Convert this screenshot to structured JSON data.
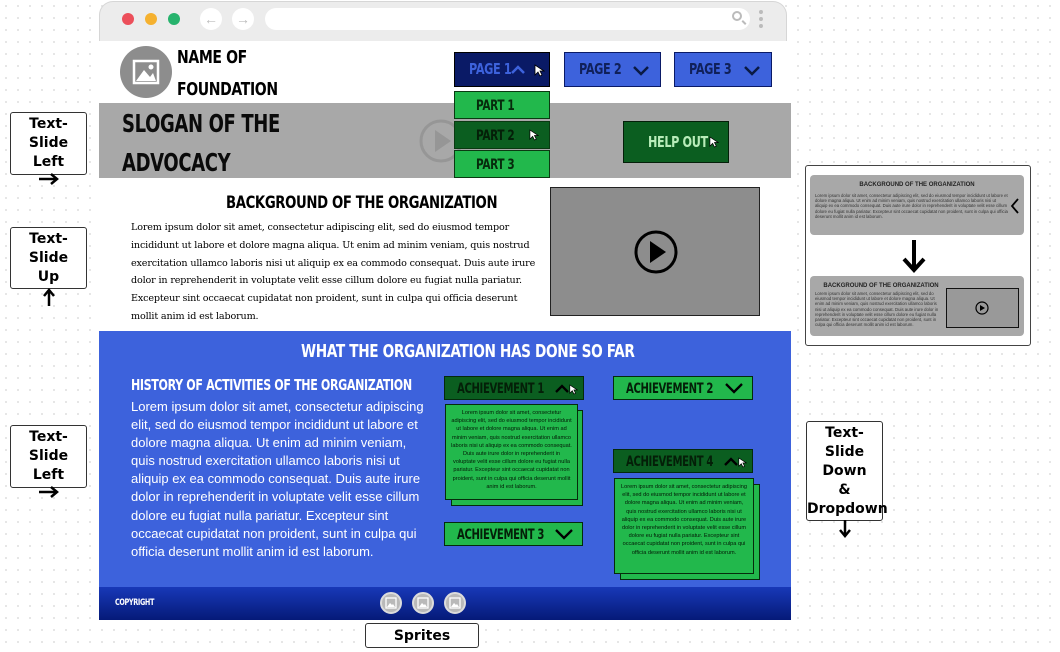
{
  "browser": {
    "dots": [
      "#ec4f5a",
      "#f5b12f",
      "#27b36d"
    ]
  },
  "header": {
    "name_line1": "NAME OF",
    "name_line2": "FOUNDATION",
    "nav": [
      {
        "label": "PAGE 1",
        "state": "open"
      },
      {
        "label": "PAGE 2",
        "state": "closed"
      },
      {
        "label": "PAGE 3",
        "state": "closed"
      }
    ],
    "dropdown": [
      "PART 1",
      "PART 2",
      "PART 3"
    ]
  },
  "hero": {
    "slogan_line1": "SLOGAN OF THE",
    "slogan_line2": "ADVOCACY",
    "help_button": "HELP OUT"
  },
  "background": {
    "title": "BACKGROUND OF THE ORGANIZATION",
    "paragraph": "Lorem ipsum dolor sit amet, consectetur adipiscing elit, sed do eiusmod tempor incididunt ut labore et dolore magna aliqua. Ut enim ad minim veniam, quis nostrud exercitation ullamco laboris nisi ut aliquip ex ea commodo consequat. Duis aute irure dolor in reprehenderit in voluptate velit esse cillum dolore eu fugiat nulla pariatur. Excepteur sint occaecat cupidatat non proident, sunt in culpa qui officia deserunt mollit anim id est laborum."
  },
  "activities": {
    "title": "WHAT THE ORGANIZATION HAS DONE SO FAR",
    "subtitle": "HISTORY OF ACTIVITIES OF THE ORGANIZATION",
    "paragraph": "Lorem ipsum dolor sit amet, consectetur adipiscing elit, sed do eiusmod tempor incididunt ut labore et dolore magna aliqua. Ut enim ad minim veniam, quis nostrud exercitation ullamco laboris nisi ut aliquip ex ea commodo consequat. Duis aute irure dolor in reprehenderit in voluptate velit esse cillum dolore eu fugiat nulla pariatur. Excepteur sint occaecat cupidatat non proident, sunt in culpa qui officia deserunt mollit anim id est laborum.",
    "achievements": [
      {
        "label": "ACHIEVEMENT 1",
        "state": "open"
      },
      {
        "label": "ACHIEVEMENT 2",
        "state": "closed"
      },
      {
        "label": "ACHIEVEMENT 3",
        "state": "closed"
      },
      {
        "label": "ACHIEVEMENT 4",
        "state": "open"
      }
    ],
    "achievement_text": "Lorem ipsum dolor sit amet, consectetur adipiscing elit, sed do eiusmod tempor incididunt ut labore et dolore magna aliqua. Ut enim ad minim veniam, quis nostrud exercitation ullamco laboris nisi ut aliquip ex ea commodo consequat. Duis aute irure dolor in reprehenderit in voluptate velit esse cillum dolore eu fugiat nulla pariatur. Excepteur sint occaecat cupidatat non proident, sunt in culpa qui officia deserunt mollit anim id est laborum."
  },
  "footer": {
    "copyright": "COPYRIGHT"
  },
  "annotations": {
    "slide_left_1": [
      "Text-Slide",
      "Left"
    ],
    "slide_up": [
      "Text-Slide",
      "Up"
    ],
    "slide_left_2": [
      "Text-Slide",
      "Left"
    ],
    "slide_down": [
      "Text-Slide",
      "Down",
      "&",
      "Dropdown"
    ],
    "sprites": "Sprites"
  },
  "preview": {
    "title": "BACKGROUND OF THE ORGANIZATION",
    "text": "Lorem ipsum dolor sit amet, consectetur adipiscing elit, sed do eiusmod tempor incididunt ut labore et dolore magna aliqua. Ut enim ad minim veniam, quis nostrud exercitation ullamco laboris nisi ut aliquip ex ea commodo consequat. Duis aute irure dolor in reprehenderit in voluptate velit esse cillum dolore eu fugiat nulla pariatur. Excepteur sint occaecat cupidatat non proident, sunt in culpa qui officia deserunt mollit anim id est laborum."
  },
  "colors": {
    "nav_blue": "#3d62dc",
    "nav_active": "#0a1a66",
    "green": "#22b84c",
    "dark_green": "#0b5e20",
    "hero_gray": "#a8a8a8"
  }
}
